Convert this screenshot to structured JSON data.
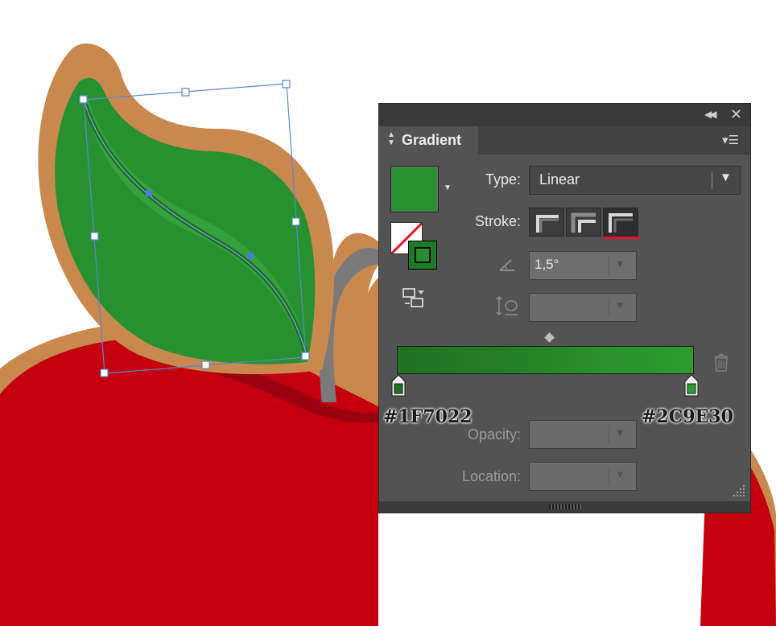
{
  "panel": {
    "title": "Gradient",
    "type_label": "Type:",
    "type_value": "Linear",
    "stroke_label": "Stroke:",
    "angle_value": "1,5°",
    "aspect_value": "",
    "opacity_label": "Opacity:",
    "opacity_value": "",
    "location_label": "Location:",
    "location_value": ""
  },
  "gradient": {
    "stop_left_color": "#1F7022",
    "stop_right_color": "#2C9E30"
  },
  "annotations": {
    "left_hex": "#1F7022",
    "right_hex": "#2C9E30"
  },
  "colors": {
    "panel_bg": "#535353",
    "apple_red": "#C4000E",
    "leaf_green": "#279130",
    "outline_tan": "#C9884E",
    "stem_gray": "#7A7A7A",
    "selection_blue": "#5A86D6",
    "stroke_highlight": "#E0142A"
  },
  "icons": {
    "collapse": "double-chevron-left-icon",
    "close": "close-icon",
    "menu": "panel-menu-icon",
    "trash": "trash-icon",
    "angle": "angle-icon",
    "aspect": "aspect-ratio-icon",
    "reverse": "reverse-gradient-icon"
  }
}
